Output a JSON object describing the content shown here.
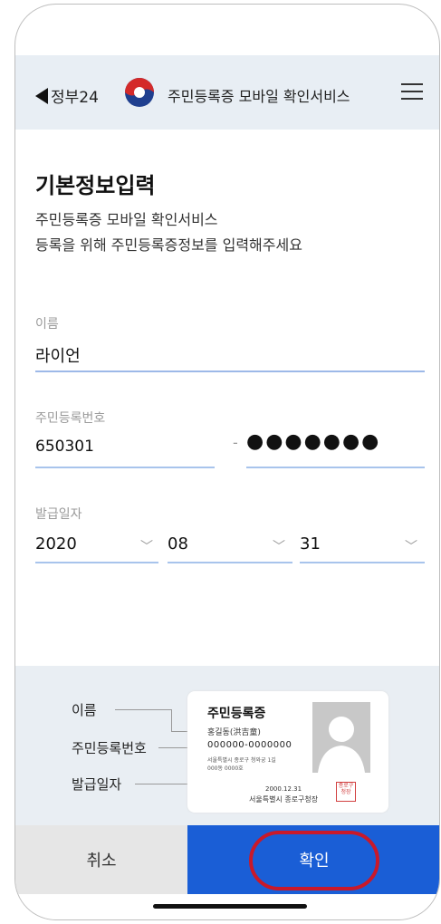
{
  "header": {
    "back_label": "정부24",
    "service_title": "주민등록증 모바일 확인서비스"
  },
  "page": {
    "title": "기본정보입력",
    "description_line1": "주민등록증 모바일 확인서비스",
    "description_line2": "등록을 위해 주민등록증정보를 입력해주세요"
  },
  "form": {
    "name_label": "이름",
    "name_value": "라이언",
    "rrn_label": "주민등록번호",
    "rrn_front": "650301",
    "rrn_separator": "-",
    "rrn_back_masked": "●●●●●●●",
    "issue_label": "발급일자",
    "issue_year": "2020",
    "issue_month": "08",
    "issue_day": "31"
  },
  "guide": {
    "label_name": "이름",
    "label_rrn": "주민등록번호",
    "label_issue": "발급일자",
    "card_title": "주민등록증",
    "card_name": "홍길동(洪吉童)",
    "card_id": "000000-0000000",
    "card_address_line1": "서울특별시 종로구 청와궁 1길",
    "card_address_line2": "000동 0000호",
    "card_date": "2000.12.31",
    "card_issuer": "서울특별시 종로구청장",
    "seal_text": "종로구청장"
  },
  "buttons": {
    "cancel_label": "취소",
    "confirm_label": "확인"
  },
  "colors": {
    "primary": "#1a5ed6",
    "highlight": "#c9192a",
    "underline": "#a8c4ec",
    "topbar_bg": "#e8eef4"
  }
}
